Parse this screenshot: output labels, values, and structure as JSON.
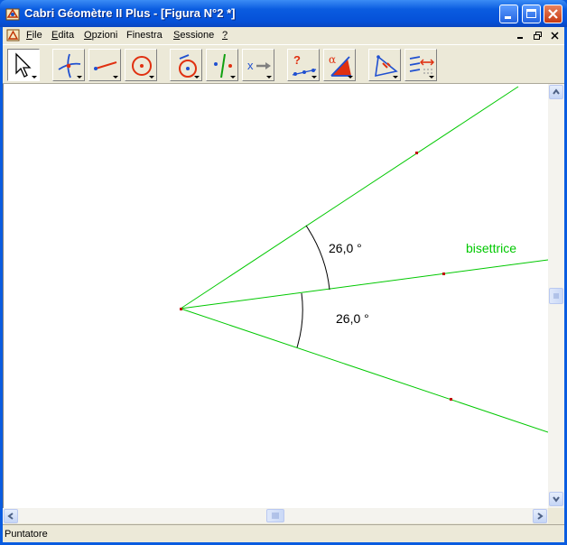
{
  "window": {
    "title": "Cabri Géomètre II Plus - [Figura N°2 *]"
  },
  "menu": {
    "items": [
      {
        "key": "F",
        "rest": "ile"
      },
      {
        "key": "E",
        "rest": "dita"
      },
      {
        "key": "O",
        "rest": "pzioni"
      },
      {
        "key": "F",
        "rest": "inestra",
        "prefix": ""
      },
      {
        "key": "S",
        "rest": "essione"
      },
      {
        "key": "?",
        "rest": ""
      }
    ]
  },
  "toolbar": {
    "tools": [
      "pointer-tool",
      "points-tool",
      "lines-tool",
      "curves-tool",
      "construct-tool",
      "transform-tool",
      "macro-tool",
      "check-property-tool",
      "measure-tool",
      "display-tool",
      "draw-tool"
    ]
  },
  "figure": {
    "angle_top_label": "26,0 °",
    "angle_bottom_label": "26,0 °",
    "bisector_label": "bisettrice",
    "line_color": "#00c800",
    "bisector_label_color": "#00c800",
    "point_color": "#c00000"
  },
  "status": {
    "text": "Puntatore"
  },
  "colors": {
    "titlebar": "#0a5ce0",
    "face": "#ece9d8"
  }
}
